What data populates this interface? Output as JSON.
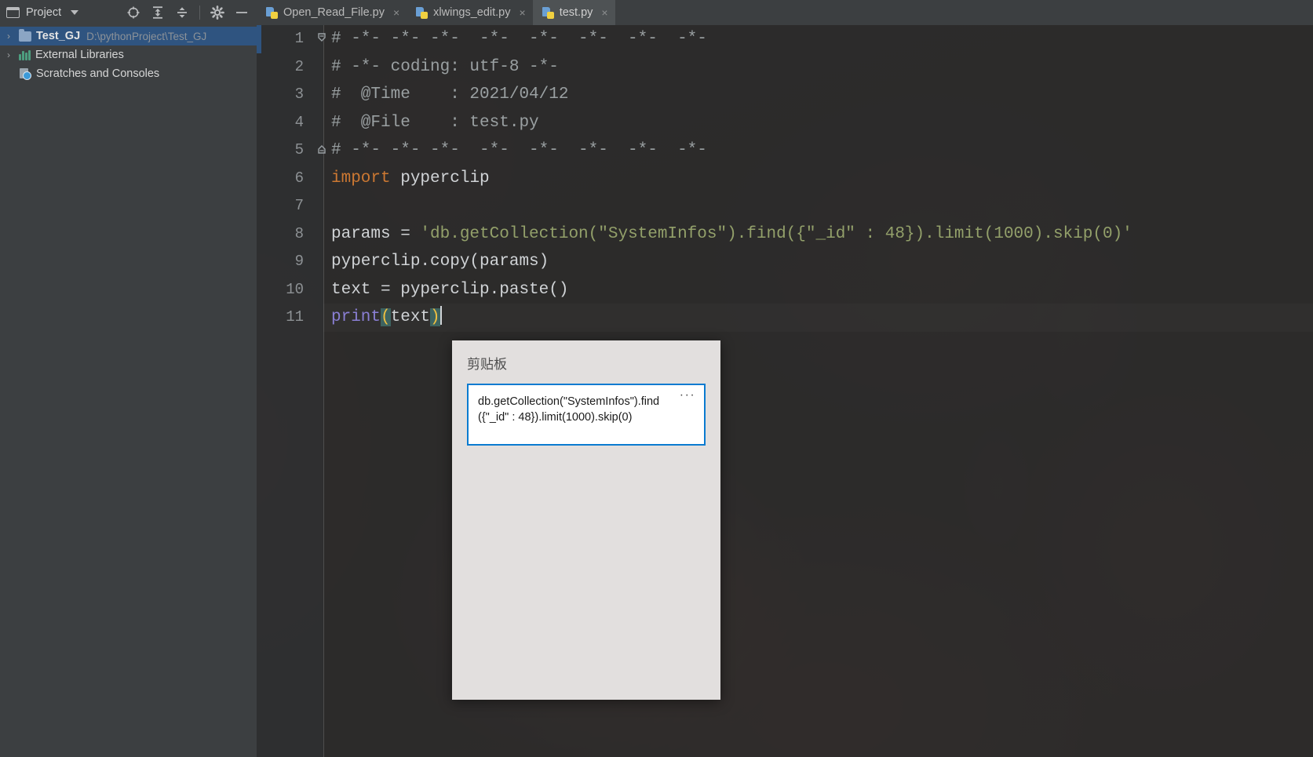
{
  "project_panel": {
    "header_label": "Project",
    "header_icon": "window-icon",
    "dropdown_icon": "chevron-down-icon",
    "tools": [
      {
        "name": "locate-icon",
        "title": "Select Opened File"
      },
      {
        "name": "expand-all-icon",
        "title": "Expand All"
      },
      {
        "name": "collapse-all-icon",
        "title": "Collapse All"
      },
      {
        "name": "gear-icon",
        "title": "Settings"
      },
      {
        "name": "minimize-icon",
        "title": "Hide"
      }
    ],
    "tree": [
      {
        "twisty": "›",
        "icon": "folder-icon",
        "name": "Test_GJ",
        "path": "D:\\pythonProject\\Test_GJ",
        "selected": true,
        "bold": true
      },
      {
        "twisty": "›",
        "icon": "library-icon",
        "name": "External Libraries",
        "path": "",
        "selected": false,
        "bold": false
      },
      {
        "twisty": "",
        "icon": "scratches-icon",
        "name": "Scratches and Consoles",
        "path": "",
        "selected": false,
        "bold": false
      }
    ]
  },
  "tabs": [
    {
      "label": "Open_Read_File.py",
      "icon": "python-file-icon",
      "close_icon": "×",
      "active": false
    },
    {
      "label": "xlwings_edit.py",
      "icon": "python-file-icon",
      "close_icon": "×",
      "active": false
    },
    {
      "label": "test.py",
      "icon": "python-file-icon",
      "close_icon": "×",
      "active": true
    }
  ],
  "editor": {
    "language": "python",
    "lines": [
      {
        "num": "1",
        "fold": "fold-start",
        "tokens": [
          {
            "cls": "tk-comment",
            "t": "# -*- -*- -*-  -*-  -*-  -*-  -*-  -*-"
          }
        ]
      },
      {
        "num": "2",
        "fold": "",
        "tokens": [
          {
            "cls": "tk-comment",
            "t": "# -*- coding: utf-8 -*-"
          }
        ]
      },
      {
        "num": "3",
        "fold": "",
        "tokens": [
          {
            "cls": "tk-comment",
            "t": "#  @Time    : 2021/04/12"
          }
        ]
      },
      {
        "num": "4",
        "fold": "",
        "tokens": [
          {
            "cls": "tk-comment",
            "t": "#  @File    : test.py"
          }
        ]
      },
      {
        "num": "5",
        "fold": "fold-end",
        "tokens": [
          {
            "cls": "tk-comment",
            "t": "# -*- -*- -*-  -*-  -*-  -*-  -*-  -*-"
          }
        ]
      },
      {
        "num": "6",
        "fold": "",
        "tokens": [
          {
            "cls": "tk-kw",
            "t": "import"
          },
          {
            "cls": "tk-plain",
            "t": " pyperclip"
          }
        ]
      },
      {
        "num": "7",
        "fold": "",
        "tokens": []
      },
      {
        "num": "8",
        "fold": "",
        "tokens": [
          {
            "cls": "tk-plain",
            "t": "params = "
          },
          {
            "cls": "tk-str",
            "t": "'db.getCollection(\"SystemInfos\").find({\"_id\" : 48}).limit(1000).skip(0)'"
          }
        ]
      },
      {
        "num": "9",
        "fold": "",
        "tokens": [
          {
            "cls": "tk-plain",
            "t": "pyperclip.copy(params)"
          }
        ]
      },
      {
        "num": "10",
        "fold": "",
        "tokens": [
          {
            "cls": "tk-plain",
            "t": "text = pyperclip.paste()"
          }
        ]
      },
      {
        "num": "11",
        "fold": "",
        "tokens": [
          {
            "cls": "tk-fn",
            "t": "print"
          },
          {
            "cls": "tk-brace hl-brace",
            "t": "("
          },
          {
            "cls": "tk-plain",
            "t": "text"
          },
          {
            "cls": "tk-brace hl-brace",
            "t": ")"
          }
        ]
      }
    ]
  },
  "clipboard_panel": {
    "title": "剪贴板",
    "items": [
      {
        "text": "db.getCollection(\"SystemInfos\").find({\"_id\" : 48}).limit(1000).skip(0)",
        "menu_icon": "···",
        "selected": true
      }
    ]
  },
  "colors": {
    "accent_blue": "#0a7bd0",
    "selection_blue": "#2f5480",
    "panel_bg": "#3c3f41",
    "editor_bg": "#2b2b2b",
    "clipboard_bg": "#e2dfde",
    "keyword_orange": "#cc7832",
    "string_green": "#93a06a",
    "function_purple": "#8a7fd4",
    "brace_yellow": "#f0c040"
  }
}
